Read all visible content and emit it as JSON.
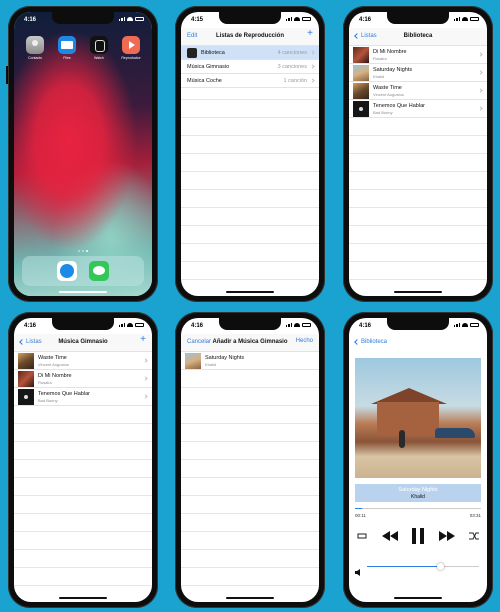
{
  "status": {
    "time": "4:16",
    "time_alt": "4:15"
  },
  "home": {
    "apps": [
      {
        "label": "Contacts",
        "icon": "contacts-icon"
      },
      {
        "label": "Files",
        "icon": "files-icon"
      },
      {
        "label": "Watch",
        "icon": "watch-icon"
      },
      {
        "label": "Reproductor",
        "icon": "player-icon"
      }
    ],
    "dock": [
      {
        "icon": "safari-icon"
      },
      {
        "icon": "messages-icon"
      }
    ]
  },
  "playlists": {
    "edit": "Edit",
    "title": "Listas de Reproducción",
    "add": "+",
    "rows": [
      {
        "name": "Biblioteca",
        "count": "4 canciones"
      },
      {
        "name": "Música Gimnasio",
        "count": "3 canciones"
      },
      {
        "name": "Música Coche",
        "count": "1 canción"
      }
    ]
  },
  "library": {
    "back": "Listas",
    "title": "Biblioteca",
    "songs": [
      {
        "title": "Di Mi Nombre",
        "artist": "Rosalía"
      },
      {
        "title": "Saturday Nights",
        "artist": "Khalid"
      },
      {
        "title": "Waste Time",
        "artist": "Vincent Augustus"
      },
      {
        "title": "Tenemos Que Hablar",
        "artist": "Bad Bunny"
      }
    ]
  },
  "gym": {
    "back": "Listas",
    "title": "Música Gimnasio",
    "add": "+",
    "songs": [
      {
        "title": "Waste Time",
        "artist": "Vincent Augustus"
      },
      {
        "title": "Di Mi Nombre",
        "artist": "Rosalía"
      },
      {
        "title": "Tenemos Que Hablar",
        "artist": "Bad Bunny"
      }
    ]
  },
  "add_sheet": {
    "cancel": "Cancelar",
    "title": "Añadir a Música Gimnasio",
    "done": "Hecho",
    "songs": [
      {
        "title": "Saturday Nights",
        "artist": "Khalid"
      }
    ]
  },
  "player": {
    "back": "Biblioteca",
    "song": "Saturday Nights",
    "artist": "Khalid",
    "elapsed": "00:11",
    "duration": "03:31",
    "progress": 0.055,
    "volume": 0.65,
    "accent": "#2f7de1"
  }
}
